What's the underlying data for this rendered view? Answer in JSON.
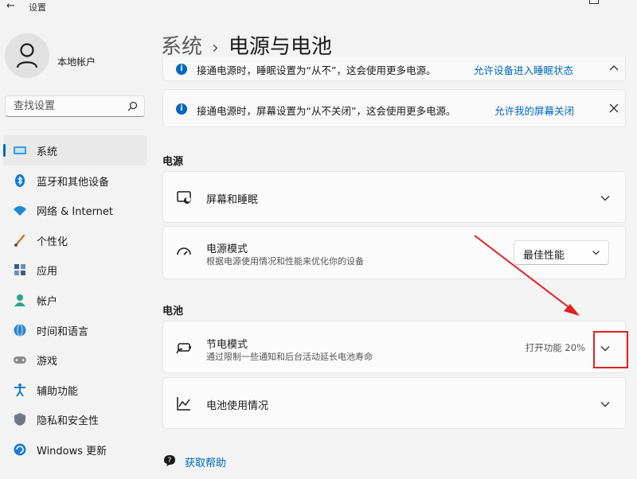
{
  "window": {
    "title": "设置"
  },
  "user": {
    "name": "本地帐户"
  },
  "search": {
    "placeholder": "查找设置"
  },
  "nav": [
    {
      "label": "系统",
      "icon": "system-icon",
      "active": true
    },
    {
      "label": "蓝牙和其他设备",
      "icon": "bluetooth-icon"
    },
    {
      "label": "网络 & Internet",
      "icon": "wifi-icon"
    },
    {
      "label": "个性化",
      "icon": "brush-icon"
    },
    {
      "label": "应用",
      "icon": "apps-icon"
    },
    {
      "label": "帐户",
      "icon": "account-icon"
    },
    {
      "label": "时间和语言",
      "icon": "globe-icon"
    },
    {
      "label": "游戏",
      "icon": "gamepad-icon"
    },
    {
      "label": "辅助功能",
      "icon": "accessibility-icon"
    },
    {
      "label": "隐私和安全性",
      "icon": "shield-icon"
    },
    {
      "label": "Windows 更新",
      "icon": "update-icon"
    }
  ],
  "breadcrumb": {
    "parent": "系统",
    "sep": "›",
    "current": "电源与电池"
  },
  "banners": {
    "sleep": {
      "text": "接通电源时，睡眠设置为“从不”，这会使用更多电源。",
      "link": "允许设备进入睡眠状态"
    },
    "screen": {
      "text": "接通电源时，屏幕设置为“从不关闭”，这会使用更多电源。",
      "link": "允许我的屏幕关闭"
    }
  },
  "sections": {
    "power": "电源",
    "battery": "电池"
  },
  "cards": {
    "screen_sleep": {
      "title": "屏幕和睡眠"
    },
    "power_mode": {
      "title": "电源模式",
      "subtitle": "根据电源使用情况和性能来优化你的设备",
      "value": "最佳性能"
    },
    "battery_saver": {
      "title": "节电模式",
      "subtitle": "通过限制一些通知和后台活动延长电池寿命",
      "status": "打开功能 20%"
    },
    "battery_usage": {
      "title": "电池使用情况"
    }
  },
  "help": {
    "label": "获取帮助"
  },
  "colors": {
    "accent": "#0067c0",
    "annotation": "#e32020"
  }
}
